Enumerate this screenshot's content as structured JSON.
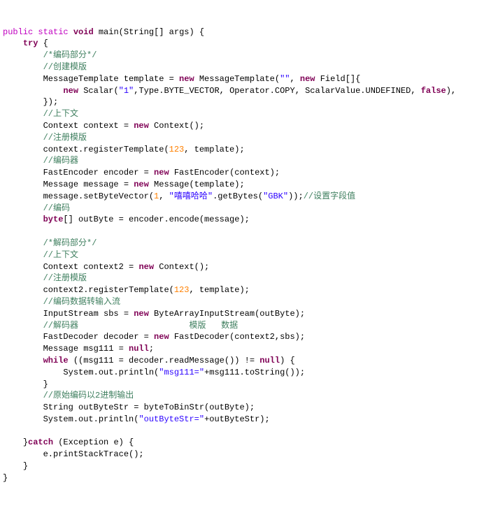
{
  "l1a": "public",
  "l1b": "static",
  "l1c": "void",
  "l1m": " main(String[] args) {",
  "l2a": "try",
  "l2b": " {",
  "l3": "/*编码部分*/",
  "l4": "//创建模版",
  "l5a": "MessageTemplate template = ",
  "l5b": "new",
  "l5c": " MessageTemplate(",
  "l5d": "\"\"",
  "l5e": ", ",
  "l5f": "new",
  "l5g": " Field[]{",
  "l6a": "new",
  "l6b": " Scalar(",
  "l6c": "\"1\"",
  "l6d": ",Type.BYTE_VECTOR, Operator.COPY, ScalarValue.UNDEFINED, ",
  "l6e": "false",
  "l6f": "),",
  "l7": "});",
  "l8": "//上下文",
  "l9a": "Context context = ",
  "l9b": "new",
  "l9c": " Context();",
  "l10": "//注册模版",
  "l11a": "context.registerTemplate(",
  "l11b": "123",
  "l11c": ", template);",
  "l12": "//编码器",
  "l13a": "FastEncoder encoder = ",
  "l13b": "new",
  "l13c": " FastEncoder(context);",
  "l14a": "Message message = ",
  "l14b": "new",
  "l14c": " Message(template);",
  "l15a": "message.setByteVector(",
  "l15b": "1",
  "l15c": ", ",
  "l15d": "\"嘻嘻哈哈\"",
  "l15e": ".getBytes(",
  "l15f": "\"GBK\"",
  "l15g": "));",
  "l15h": "//设置字段值",
  "l16": "//编码",
  "l17a": "byte",
  "l17b": "[] outByte = encoder.encode(message);",
  "l18": "",
  "l19": "/*解码部分*/",
  "l20": "//上下文",
  "l21a": "Context context2 = ",
  "l21b": "new",
  "l21c": " Context();",
  "l22": "//注册模版",
  "l23a": "context2.registerTemplate(",
  "l23b": "123",
  "l23c": ", template);",
  "l24": "//编码数据转输入流",
  "l25a": "InputStream sbs = ",
  "l25b": "new",
  "l25c": " ByteArrayInputStream(outByte);",
  "l26a": "//解码器",
  "l26b": "模版",
  "l26c": "数据",
  "l27a": "FastDecoder decoder = ",
  "l27b": "new",
  "l27c": " FastDecoder(context2,sbs);",
  "l28a": "Message msg111 = ",
  "l28b": "null",
  "l28c": ";",
  "l29a": "while",
  "l29b": " ((msg111 = decoder.readMessage()) != ",
  "l29c": "null",
  "l29d": ") {",
  "l30a": "System.out.println(",
  "l30b": "\"msg111=\"",
  "l30c": "+msg111.toString());",
  "l31": "}",
  "l32": "//原始编码以2进制输出",
  "l33": "String outByteStr = byteToBinStr(outByte);",
  "l34a": "System.out.println(",
  "l34b": "\"outByteStr=\"",
  "l34c": "+outByteStr);",
  "l35": "",
  "l36a": "}",
  "l36b": "catch",
  "l36c": " (Exception e) {",
  "l37": "e.printStackTrace();",
  "l38": "}",
  "l39": "}"
}
